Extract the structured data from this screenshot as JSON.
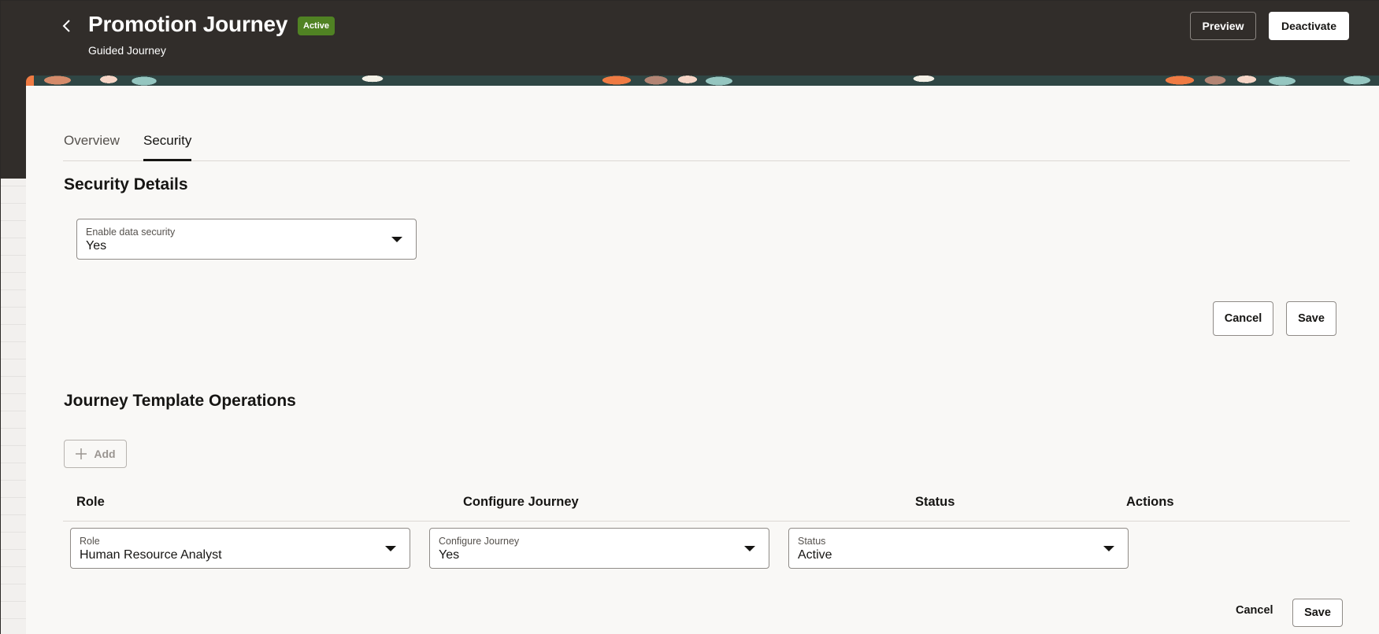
{
  "header": {
    "title": "Promotion Journey",
    "status_badge": "Active",
    "subtitle": "Guided Journey",
    "preview_label": "Preview",
    "deactivate_label": "Deactivate"
  },
  "tabs": [
    {
      "label": "Overview",
      "active": false
    },
    {
      "label": "Security",
      "active": true
    }
  ],
  "security_details": {
    "heading": "Security Details",
    "enable_data_security": {
      "label": "Enable data security",
      "value": "Yes"
    },
    "cancel_label": "Cancel",
    "save_label": "Save"
  },
  "operations": {
    "heading": "Journey Template Operations",
    "add_label": "Add",
    "columns": [
      "Role",
      "Configure Journey",
      "Status",
      "Actions"
    ],
    "rows": [
      {
        "role": {
          "label": "Role",
          "value": "Human Resource Analyst"
        },
        "configure": {
          "label": "Configure Journey",
          "value": "Yes"
        },
        "status": {
          "label": "Status",
          "value": "Active"
        }
      }
    ],
    "cancel_label": "Cancel",
    "save_label": "Save"
  },
  "icons": {
    "back": "chevron-left-icon",
    "dropdown": "caret-down-icon",
    "add": "plus-icon"
  },
  "colors": {
    "header_bg": "#312d2a",
    "badge_bg": "#508223",
    "panel_bg": "#f9f8f6"
  }
}
